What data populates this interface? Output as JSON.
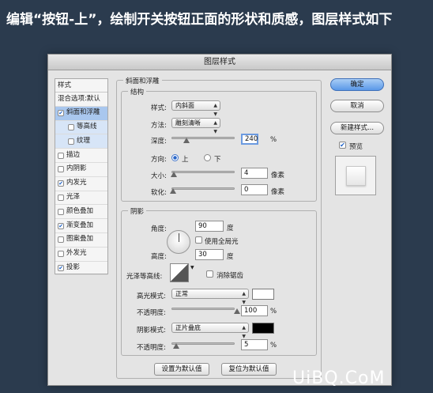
{
  "headline": "编辑“按钮-上”，绘制开关按钮正面的形状和质感，图层样式如下",
  "dialog": {
    "title": "图层样式",
    "sidebar": {
      "header": "样式",
      "items": [
        {
          "label": "混合选项:默认",
          "checkbox": false
        },
        {
          "label": "斜面和浮雕",
          "checkbox": true,
          "checked": true
        },
        {
          "label": "等高线",
          "checkbox": true,
          "checked": false
        },
        {
          "label": "纹理",
          "checkbox": true,
          "checked": false
        },
        {
          "label": "描边",
          "checkbox": true,
          "checked": false
        },
        {
          "label": "内阴影",
          "checkbox": true,
          "checked": false
        },
        {
          "label": "内发光",
          "checkbox": true,
          "checked": true
        },
        {
          "label": "光泽",
          "checkbox": true,
          "checked": false
        },
        {
          "label": "颜色叠加",
          "checkbox": true,
          "checked": false
        },
        {
          "label": "渐变叠加",
          "checkbox": true,
          "checked": true
        },
        {
          "label": "图案叠加",
          "checkbox": true,
          "checked": false
        },
        {
          "label": "外发光",
          "checkbox": true,
          "checked": false
        },
        {
          "label": "投影",
          "checkbox": true,
          "checked": true
        }
      ]
    },
    "bevel": {
      "legend": "斜面和浮雕",
      "structure": {
        "legend": "结构",
        "style_label": "样式:",
        "style_value": "内斜面",
        "technique_label": "方法:",
        "technique_value": "雕刻清晰",
        "depth_label": "深度:",
        "depth_value": "240",
        "depth_unit": "%",
        "depth_fraction": 0.24,
        "direction_label": "方向:",
        "dir_up": "上",
        "dir_down": "下",
        "size_label": "大小:",
        "size_value": "4",
        "size_unit": "像素",
        "size_fraction": 0.02,
        "soften_label": "软化:",
        "soften_value": "0",
        "soften_unit": "像素",
        "soften_fraction": 0.0
      },
      "shading": {
        "legend": "阴影",
        "angle_label": "角度:",
        "angle_value": "90",
        "angle_unit": "度",
        "global_light_label": "使用全局光",
        "altitude_label": "高度:",
        "altitude_value": "30",
        "altitude_unit": "度",
        "gloss_label": "光泽等高线:",
        "antialias_label": "消除锯齿",
        "highlight_mode_label": "高光模式:",
        "highlight_mode_value": "正常",
        "highlight_color": "#ffffff",
        "highlight_opacity_label": "不透明度:",
        "highlight_opacity_value": "100",
        "highlight_opacity_unit": "%",
        "highlight_opacity_fraction": 1.0,
        "shadow_mode_label": "阴影模式:",
        "shadow_mode_value": "正片叠底",
        "shadow_color": "#000000",
        "shadow_opacity_label": "不透明度:",
        "shadow_opacity_value": "5",
        "shadow_opacity_unit": "%",
        "shadow_opacity_fraction": 0.05
      },
      "make_default": "设置为默认值",
      "reset_default": "复位为默认值"
    },
    "buttons": {
      "ok": "确定",
      "cancel": "取消",
      "new_style": "新建样式...",
      "preview": "预览"
    }
  },
  "watermark": "UiBQ.CoM"
}
